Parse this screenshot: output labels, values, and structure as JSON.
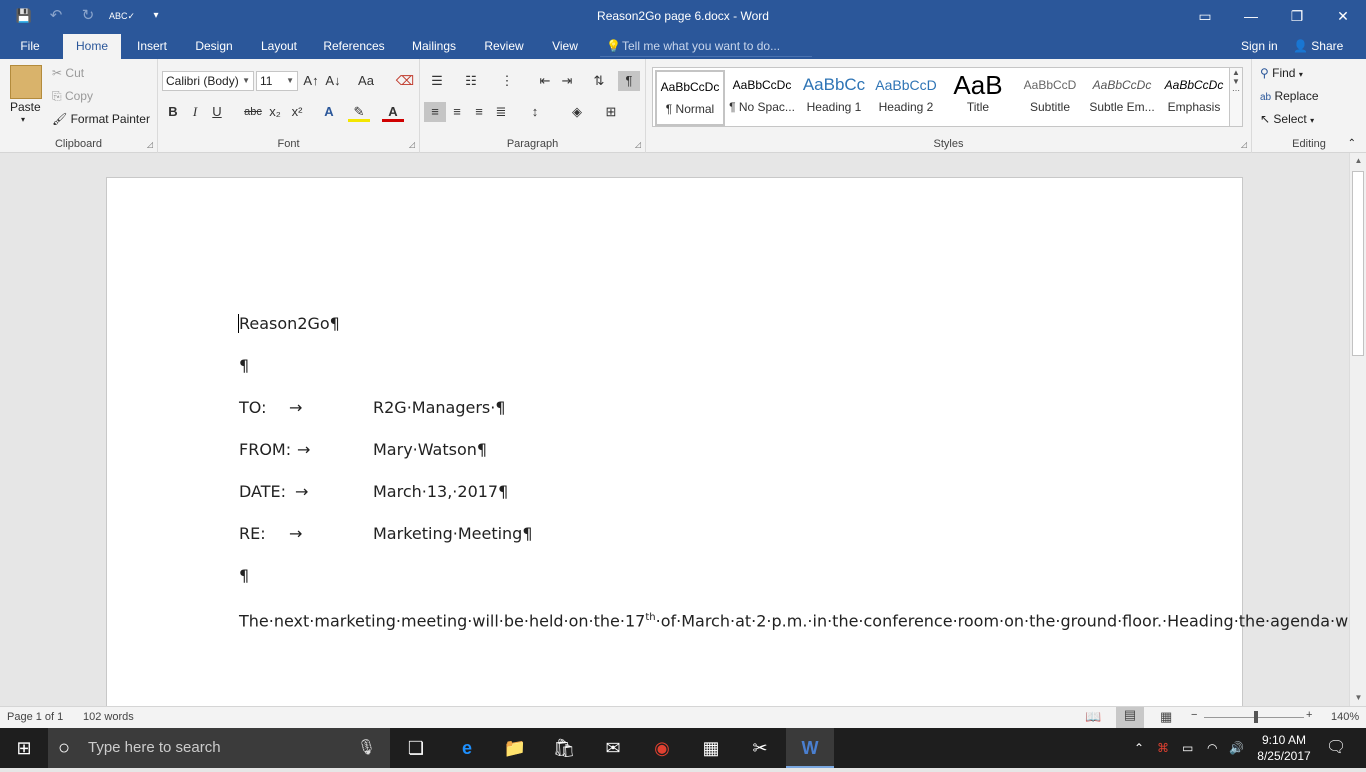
{
  "window": {
    "title": "Reason2Go page 6.docx - Word"
  },
  "qat": {
    "save": "💾",
    "undo": "↶",
    "redo": "↻",
    "spell": "ABC✓",
    "customize": "▾"
  },
  "menu": {
    "tabs": [
      "File",
      "Home",
      "Insert",
      "Design",
      "Layout",
      "References",
      "Mailings",
      "Review",
      "View"
    ],
    "tellme": "Tell me what you want to do...",
    "signin": "Sign in",
    "share": "Share"
  },
  "clipboard": {
    "paste": "Paste",
    "cut": "Cut",
    "copy": "Copy",
    "format_painter": "Format Painter",
    "label": "Clipboard"
  },
  "font": {
    "name": "Calibri (Body)",
    "size": "11",
    "label": "Font",
    "bold": "B",
    "italic": "I",
    "underline": "U",
    "strike": "abc",
    "sub": "x₂",
    "sup": "x²",
    "grow": "A↑",
    "shrink": "A↓",
    "case": "Aa"
  },
  "paragraph": {
    "label": "Paragraph",
    "pilcrow": "¶"
  },
  "styles": {
    "label": "Styles",
    "items": [
      {
        "sample": "AaBbCcDc",
        "name": "¶ Normal"
      },
      {
        "sample": "AaBbCcDc",
        "name": "¶ No Spac..."
      },
      {
        "sample": "AaBbCc",
        "name": "Heading 1"
      },
      {
        "sample": "AaBbCcD",
        "name": "Heading 2"
      },
      {
        "sample": "AaB",
        "name": "Title"
      },
      {
        "sample": "AaBbCcD",
        "name": "Subtitle"
      },
      {
        "sample": "AaBbCcDc",
        "name": "Subtle Em..."
      },
      {
        "sample": "AaBbCcDc",
        "name": "Emphasis"
      }
    ]
  },
  "editing": {
    "find": "Find",
    "replace": "Replace",
    "select": "Select",
    "label": "Editing"
  },
  "document": {
    "line1": "Reason2Go¶",
    "blank1": "¶",
    "to_label": "TO:",
    "to_value": "R2G·Managers·¶",
    "from_label": "FROM:",
    "from_value": "Mary·Watson¶",
    "date_label": "DATE:",
    "date_value": "March·13,·2017¶",
    "re_label": "RE:",
    "re_value": "Marketing·Meeting¶",
    "blank2": "¶",
    "body_pre": "The·next·marketing·meeting·will·be·held·on·the·17",
    "body_sup": "th",
    "body_post": "·of·March·at·2·p.m.·in·the·conference·room·on·the·ground·floor.·Heading·the·agenda·will·be·the·launch·on·our·Sea·Turtle·Conversation·Project,·a·rewarding·opportunity·to·supervise·hatcheries,·count·and·release·baby·turtles,·and·patrol·the·nighttime·shores·of·Costa·Rica.·The·project·is·scheduled·to·begin·in·September·2017.¶",
    "tab_arrow": "→"
  },
  "status": {
    "page": "Page 1 of 1",
    "words": "102 words",
    "zoom": "140%"
  },
  "taskbar": {
    "search": "Type here to search",
    "time": "9:10 AM",
    "date": "8/25/2017"
  }
}
